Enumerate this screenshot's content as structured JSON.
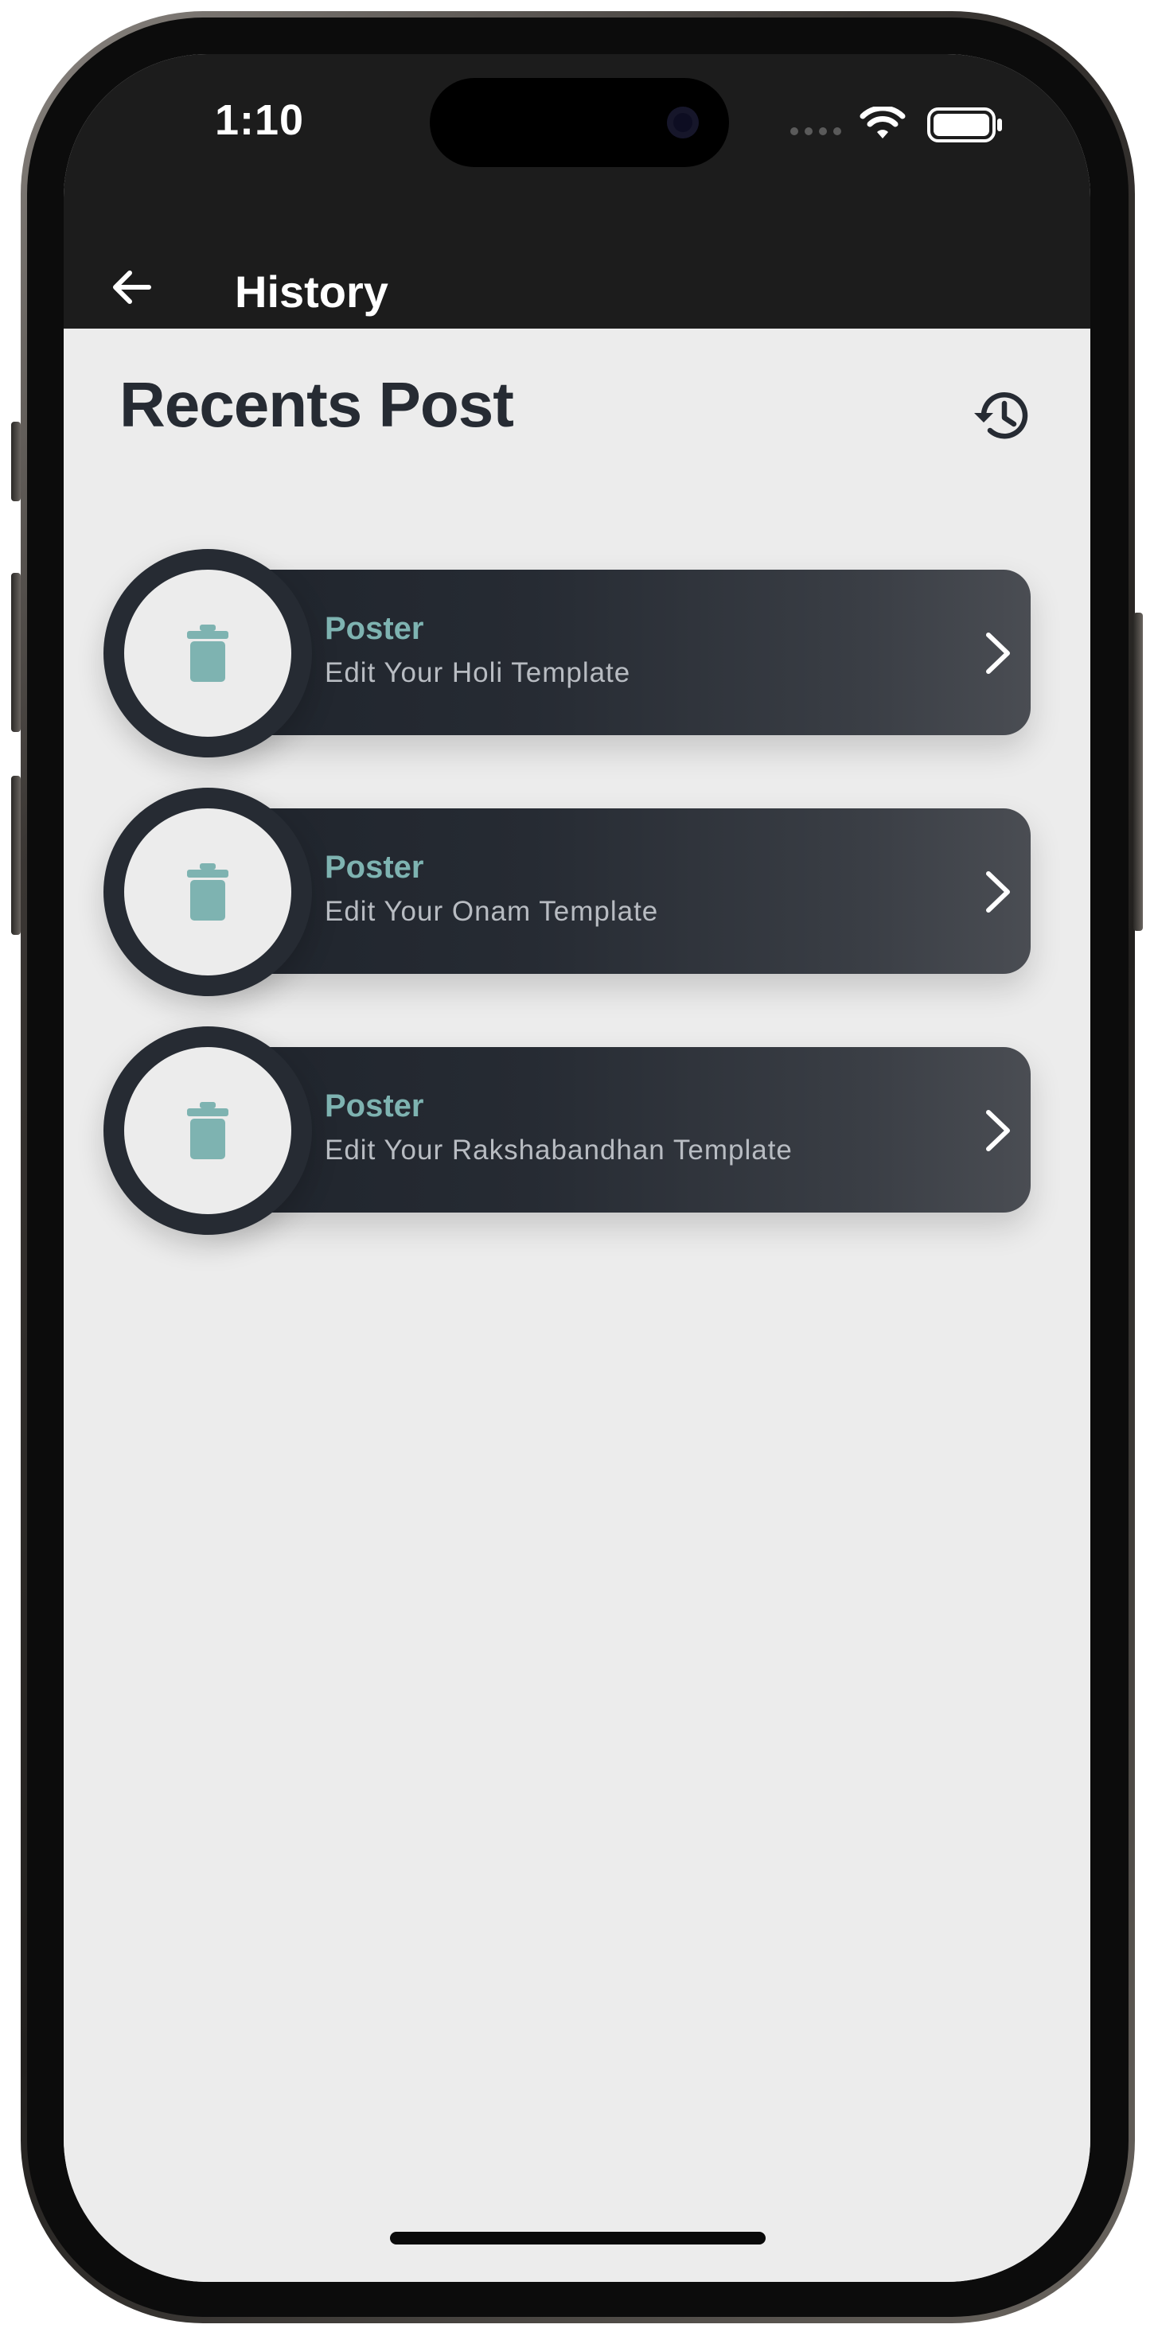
{
  "status_bar": {
    "time": "1:10"
  },
  "appbar": {
    "title": "History",
    "back_icon": "arrow-left-icon"
  },
  "section": {
    "title": "Recents Post",
    "history_icon": "history-icon"
  },
  "posts": [
    {
      "kicker": "Poster",
      "text": "Edit Your Holi Template"
    },
    {
      "kicker": "Poster",
      "text": "Edit Your Onam Template"
    },
    {
      "kicker": "Poster",
      "text": "Edit Your Rakshabandhan Template"
    }
  ],
  "colors": {
    "appbar_bg": "#1c1c1c",
    "content_bg": "#ececec",
    "card_dark": "#262b33",
    "accent_teal": "#7eb3b1",
    "title_text": "#262b33"
  }
}
